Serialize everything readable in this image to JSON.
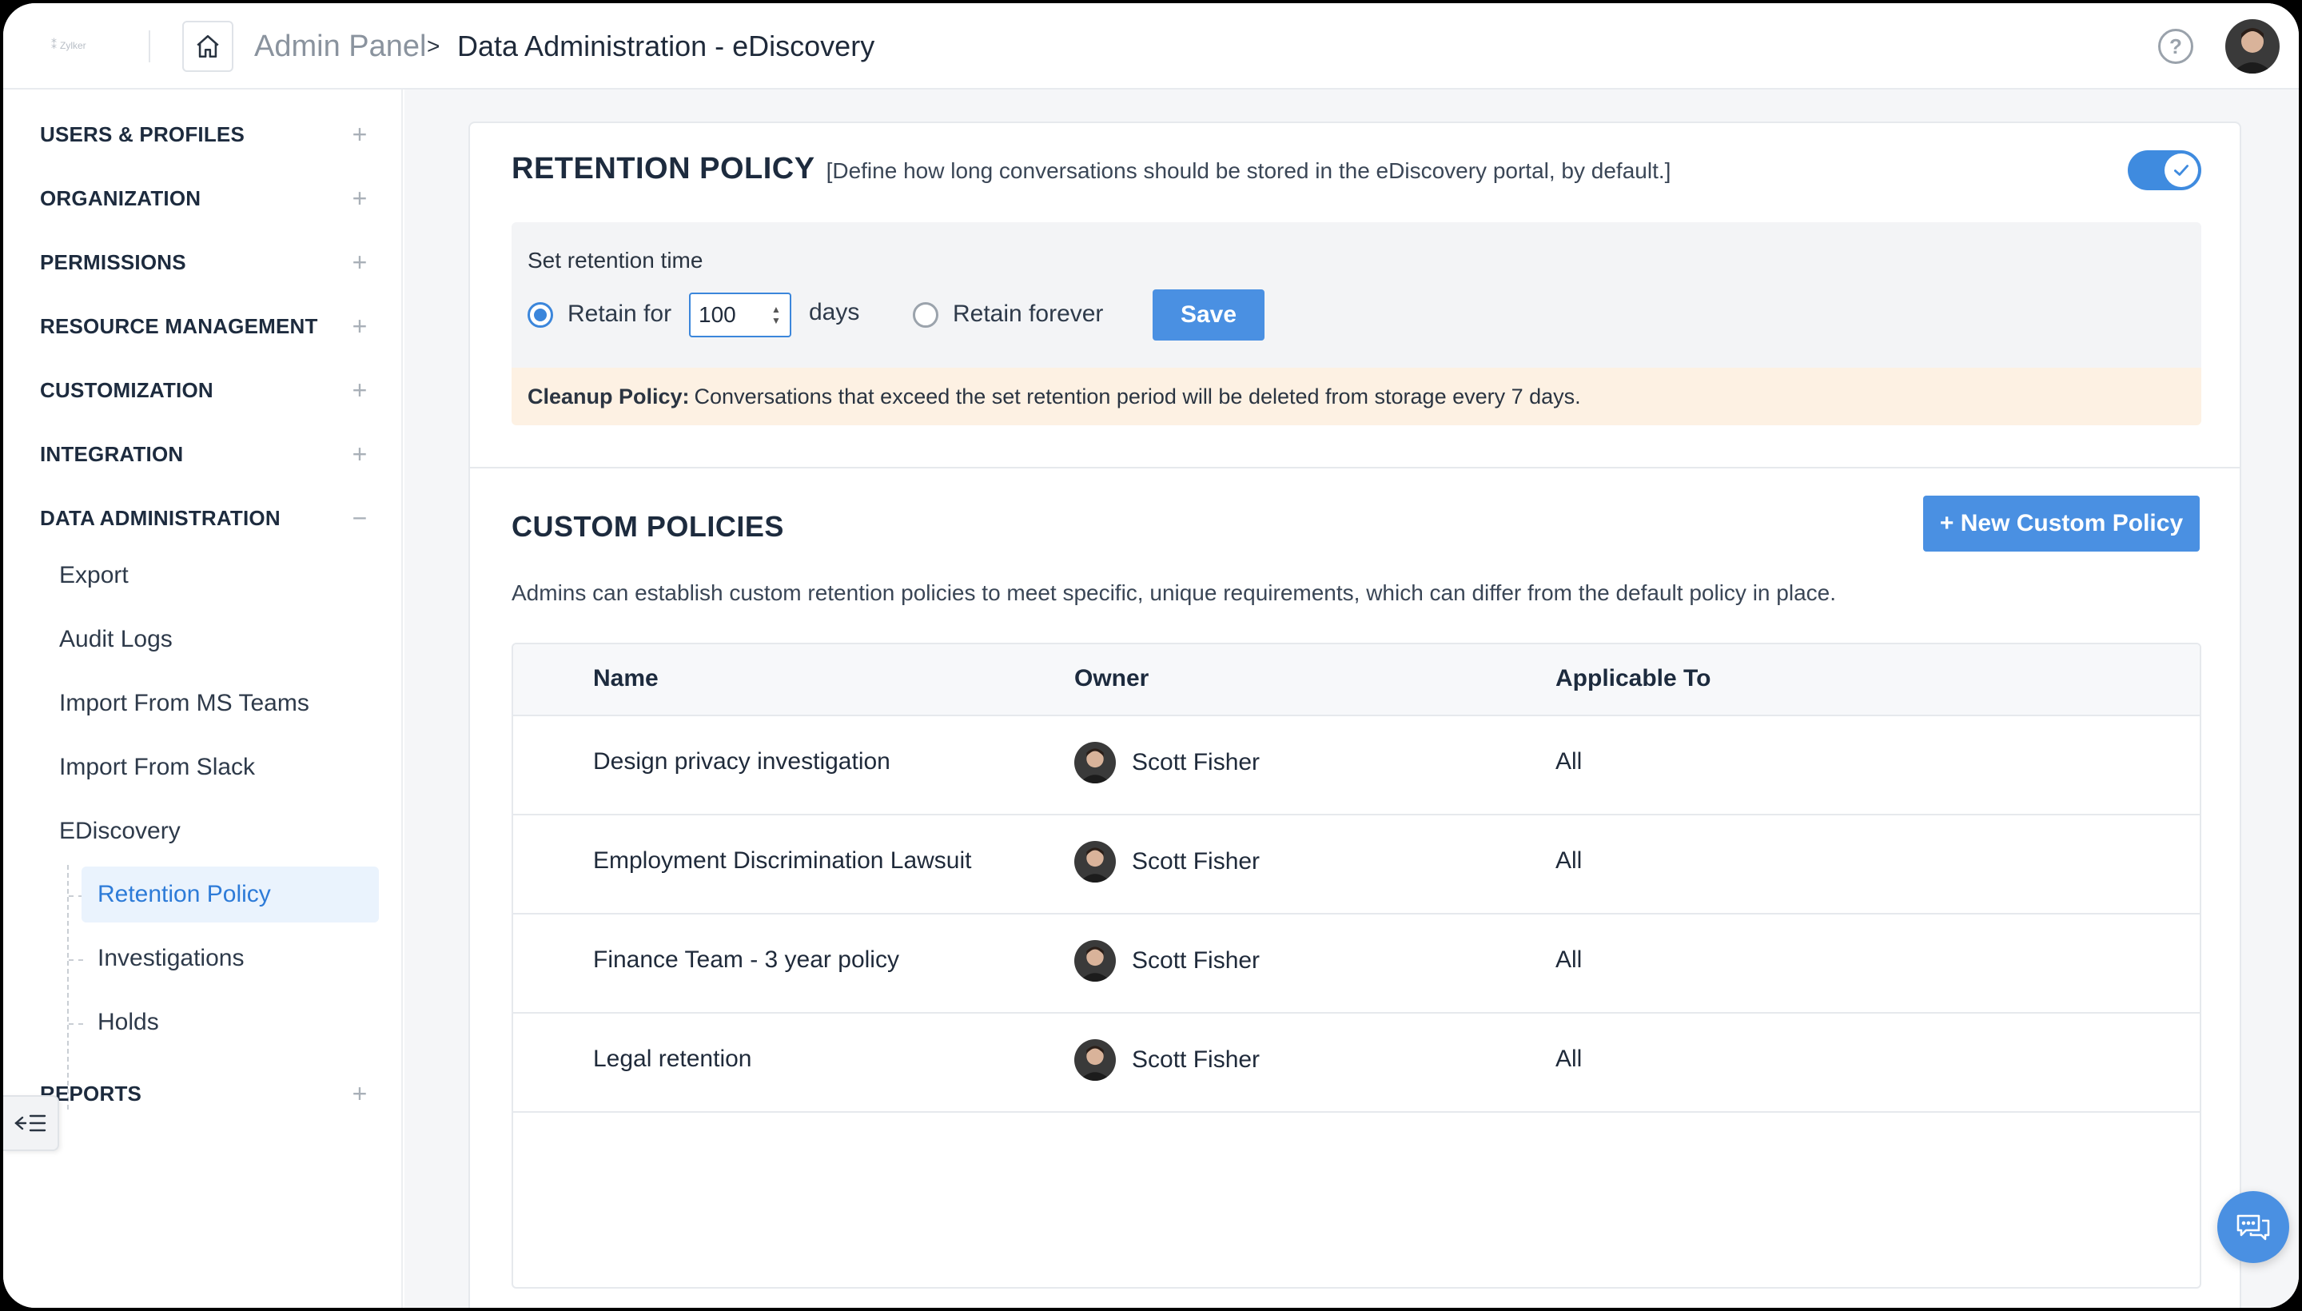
{
  "header": {
    "logo_text": "Zylker",
    "breadcrumb_root": "Admin Panel",
    "breadcrumb_separator": ">",
    "breadcrumb_current": "Data Administration - eDiscovery",
    "help_glyph": "?"
  },
  "sidebar": {
    "sections": [
      {
        "label": "USERS & PROFILES",
        "toggle": "+"
      },
      {
        "label": "ORGANIZATION",
        "toggle": "+"
      },
      {
        "label": "PERMISSIONS",
        "toggle": "+"
      },
      {
        "label": "RESOURCE MANAGEMENT",
        "toggle": "+"
      },
      {
        "label": "CUSTOMIZATION",
        "toggle": "+"
      },
      {
        "label": "INTEGRATION",
        "toggle": "+"
      },
      {
        "label": "DATA ADMINISTRATION",
        "toggle": "−"
      },
      {
        "label": "REPORTS",
        "toggle": "+"
      }
    ],
    "data_admin_items": [
      "Export",
      "Audit Logs",
      "Import From MS Teams",
      "Import From Slack",
      "EDiscovery"
    ],
    "ediscovery_items": [
      "Retention Policy",
      "Investigations",
      "Holds"
    ]
  },
  "retention_policy": {
    "title": "RETENTION POLICY",
    "description": "[Define how long conversations should be stored in the eDiscovery portal, by default.]",
    "enabled": true,
    "set_time_label": "Set retention time",
    "retain_for_label": "Retain for",
    "retain_days_value": "100",
    "days_label": "days",
    "retain_forever_label": "Retain forever",
    "selected_option": "retain_for",
    "save_label": "Save",
    "cleanup_label": "Cleanup Policy:",
    "cleanup_text": "Conversations that exceed the set retention period will be deleted from storage every 7 days."
  },
  "custom_policies": {
    "title": "CUSTOM POLICIES",
    "new_button_label": "+ New Custom Policy",
    "description": "Admins can establish custom retention policies to meet specific, unique requirements, which can differ from the default policy in place.",
    "columns": [
      "Name",
      "Owner",
      "Applicable To"
    ],
    "rows": [
      {
        "name": "Design privacy investigation",
        "owner": "Scott Fisher",
        "applicable_to": "All"
      },
      {
        "name": "Employment Discrimination Lawsuit",
        "owner": "Scott Fisher",
        "applicable_to": "All"
      },
      {
        "name": "Finance Team - 3 year policy",
        "owner": "Scott Fisher",
        "applicable_to": "All"
      },
      {
        "name": "Legal retention",
        "owner": "Scott Fisher",
        "applicable_to": "All"
      }
    ]
  },
  "colors": {
    "accent": "#4a90e2",
    "active_nav_bg": "#eaf3fd",
    "cleanup_bg": "#fdf1e3"
  },
  "icons": {
    "home": "home-icon",
    "help": "help-icon",
    "toggle_check": "check-icon",
    "collapse": "collapse-sidebar-icon",
    "chat": "chat-icon"
  }
}
